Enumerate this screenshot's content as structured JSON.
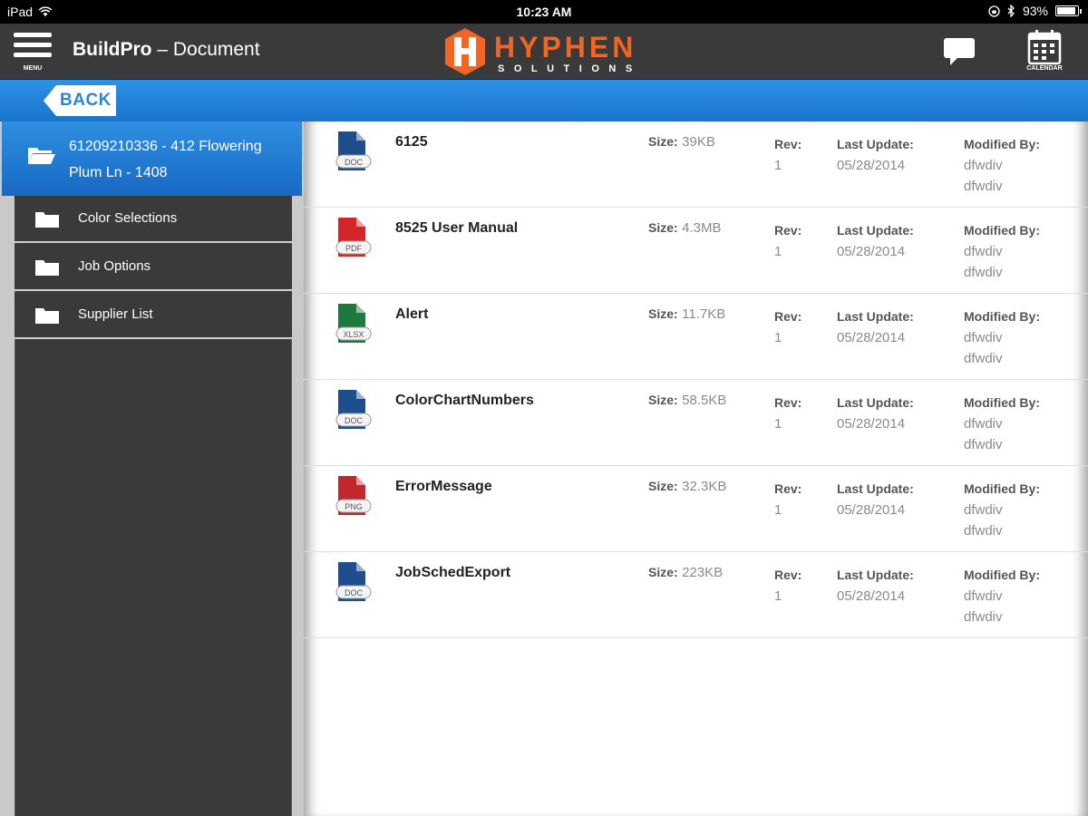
{
  "status_bar": {
    "device": "iPad",
    "time": "10:23 AM",
    "battery": "93%",
    "battery_level": 0.93
  },
  "header": {
    "menu_label": "MENU",
    "app_name": "BuildPro",
    "separator": " – ",
    "page_name": "Document",
    "logo": {
      "word": "HYPHEN",
      "sub": "SOLUTIONS",
      "colors": {
        "orange": "#f26522",
        "white": "#ffffff"
      }
    },
    "calendar_label": "CALENDAR"
  },
  "back_button": {
    "label": "BACK"
  },
  "sidebar": {
    "job": {
      "label": "61209210336 - 412 Flowering Plum Ln - 1408"
    },
    "items": [
      {
        "label": "Color Selections"
      },
      {
        "label": "Job Options"
      },
      {
        "label": "Supplier List"
      }
    ]
  },
  "labels": {
    "size": "Size:",
    "rev": "Rev:",
    "last_update": "Last Update:",
    "modified_by": "Modified By:"
  },
  "documents": [
    {
      "name": "6125",
      "type": "DOC",
      "size": "39KB",
      "rev": "1",
      "date": "05/28/2014",
      "user1": "dfwdiv",
      "user2": "dfwdiv"
    },
    {
      "name": "8525 User Manual",
      "type": "PDF",
      "size": "4.3MB",
      "rev": "1",
      "date": "05/28/2014",
      "user1": "dfwdiv",
      "user2": "dfwdiv"
    },
    {
      "name": "Alert",
      "type": "XLSX",
      "size": "11.7KB",
      "rev": "1",
      "date": "05/28/2014",
      "user1": "dfwdiv",
      "user2": "dfwdiv"
    },
    {
      "name": "ColorChartNumbers",
      "type": "DOC",
      "size": "58.5KB",
      "rev": "1",
      "date": "05/28/2014",
      "user1": "dfwdiv",
      "user2": "dfwdiv"
    },
    {
      "name": "ErrorMessage",
      "type": "PNG",
      "size": "32.3KB",
      "rev": "1",
      "date": "05/28/2014",
      "user1": "dfwdiv",
      "user2": "dfwdiv"
    },
    {
      "name": "JobSchedExport",
      "type": "DOC",
      "size": "223KB",
      "rev": "1",
      "date": "05/28/2014",
      "user1": "dfwdiv",
      "user2": "dfwdiv"
    }
  ],
  "icon_colors": {
    "DOC": "#1f4e8c",
    "PDF": "#d3262b",
    "XLSX": "#1e7a3c",
    "PNG": "#c1272d"
  },
  "theme": {
    "accent_blue": "#1f7ad6",
    "dark": "#3a3a3a"
  }
}
